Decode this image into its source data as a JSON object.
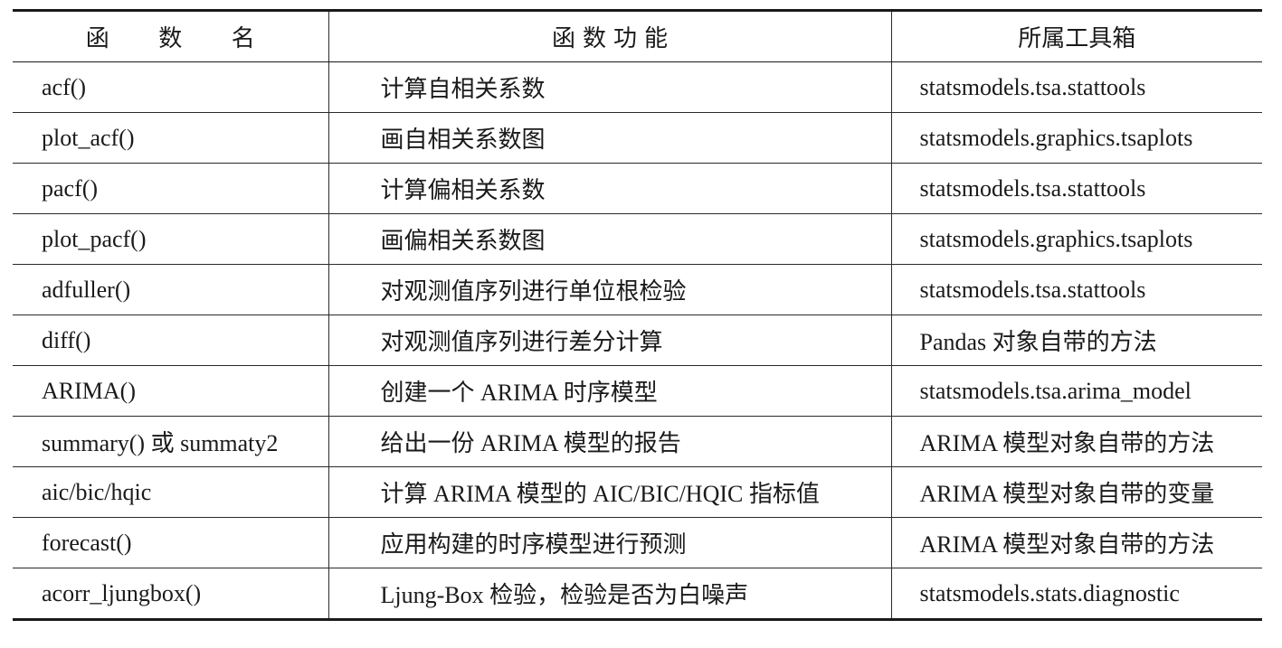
{
  "table": {
    "headers": [
      "函 数 名",
      "函数功能",
      "所属工具箱"
    ],
    "rows": [
      {
        "name": "acf()",
        "function": "计算自相关系数",
        "toolbox": "statsmodels.tsa.stattools"
      },
      {
        "name": "plot_acf()",
        "function": "画自相关系数图",
        "toolbox": "statsmodels.graphics.tsaplots"
      },
      {
        "name": "pacf()",
        "function": "计算偏相关系数",
        "toolbox": "statsmodels.tsa.stattools"
      },
      {
        "name": "plot_pacf()",
        "function": "画偏相关系数图",
        "toolbox": "statsmodels.graphics.tsaplots"
      },
      {
        "name": "adfuller()",
        "function": "对观测值序列进行单位根检验",
        "toolbox": "statsmodels.tsa.stattools"
      },
      {
        "name": "diff()",
        "function": "对观测值序列进行差分计算",
        "toolbox": "Pandas 对象自带的方法"
      },
      {
        "name": "ARIMA()",
        "function": "创建一个 ARIMA 时序模型",
        "toolbox": "statsmodels.tsa.arima_model"
      },
      {
        "name": "summary() 或 summaty2",
        "function": "给出一份 ARIMA 模型的报告",
        "toolbox": "ARIMA 模型对象自带的方法"
      },
      {
        "name": "aic/bic/hqic",
        "function": "计算 ARIMA 模型的 AIC/BIC/HQIC 指标值",
        "toolbox": "ARIMA 模型对象自带的变量"
      },
      {
        "name": "forecast()",
        "function": "应用构建的时序模型进行预测",
        "toolbox": "ARIMA 模型对象自带的方法"
      },
      {
        "name": "acorr_ljungbox()",
        "function": "Ljung-Box 检验，检验是否为白噪声",
        "toolbox": "statsmodels.stats.diagnostic"
      }
    ]
  }
}
